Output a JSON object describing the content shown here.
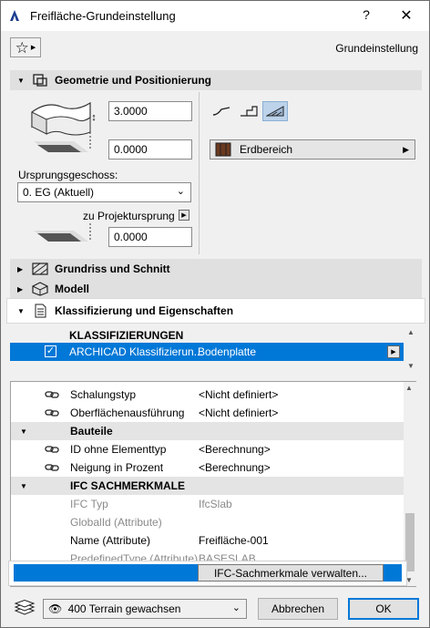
{
  "window": {
    "title": "Freifläche-Grundeinstellung",
    "help": "?",
    "close": "✕"
  },
  "header": {
    "favorites_icon": "star-icon",
    "right_label": "Grundeinstellung"
  },
  "panels": {
    "geometry": {
      "label": "Geometrie und Positionierung",
      "expanded": true
    },
    "floorplan": {
      "label": "Grundriss und Schnitt",
      "expanded": false
    },
    "model": {
      "label": "Modell",
      "expanded": false
    },
    "classification": {
      "label": "Klassifizierung und Eigenschaften",
      "expanded": true
    }
  },
  "geometry": {
    "thickness": "3.0000",
    "offset": "0.0000",
    "home_story_label": "Ursprungsgeschoss:",
    "home_story_value": "0. EG (Aktuell)",
    "project_origin_label": "zu Projektursprung",
    "project_origin_value": "0.0000",
    "material": "Erdbereich"
  },
  "classification": {
    "header": "KLASSIFIZIERUNGEN",
    "selected_row": {
      "system": "ARCHICAD Klassifizierun...",
      "value": "Bodenplatte",
      "checked": true
    }
  },
  "properties": [
    {
      "type": "prop",
      "name": "Schalungstyp",
      "value": "<Nicht definiert>",
      "grey": false,
      "linked": true
    },
    {
      "type": "prop",
      "name": "Oberflächenausführung",
      "value": "<Nicht definiert>",
      "grey": false,
      "linked": true
    },
    {
      "type": "group",
      "name": "Bauteile"
    },
    {
      "type": "prop",
      "name": "ID ohne Elementtyp",
      "value": "<Berechnung>",
      "grey": false,
      "linked": true
    },
    {
      "type": "prop",
      "name": "Neigung in Prozent",
      "value": "<Berechnung>",
      "grey": false,
      "linked": true
    },
    {
      "type": "group",
      "name": "IFC SACHMERKMALE"
    },
    {
      "type": "prop",
      "name": "IFC Typ",
      "value": "IfcSlab",
      "grey": true,
      "linked": false
    },
    {
      "type": "prop",
      "name": "GlobalId (Attribute)",
      "value": "",
      "grey": true,
      "linked": false
    },
    {
      "type": "prop",
      "name": "Name (Attribute)",
      "value": "Freifläche-001",
      "grey": false,
      "linked": false
    },
    {
      "type": "prop",
      "name": "PredefinedType (Attribute)",
      "value": "BASESLAB",
      "grey": true,
      "linked": false
    }
  ],
  "manage_ifc_button": "IFC-Sachmerkmale verwalten...",
  "footer": {
    "layer": "400 Terrain gewachsen",
    "cancel": "Abbrechen",
    "ok": "OK"
  },
  "colors": {
    "selection": "#0078d7",
    "accent_focus": "#0078d7"
  }
}
